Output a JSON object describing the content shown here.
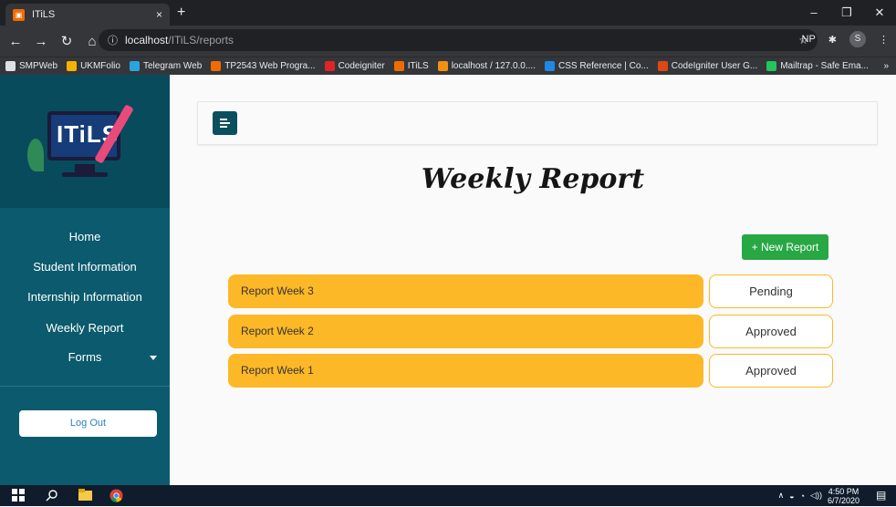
{
  "browser": {
    "tab_title": "ITiLS",
    "tab_close": "×",
    "new_tab": "+",
    "url_host": "localhost",
    "url_path": "/ITiLS/reports",
    "profile_initial": "S",
    "ext_np": "NP",
    "bookmarks": [
      {
        "label": "SMPWeb",
        "color": "#dfe1e5"
      },
      {
        "label": "UKMFolio",
        "color": "#f2b400"
      },
      {
        "label": "Telegram Web",
        "color": "#2aa3df"
      },
      {
        "label": "TP2543 Web Progra...",
        "color": "#ef6c00"
      },
      {
        "label": "Codeigniter",
        "color": "#e02424"
      },
      {
        "label": "ITiLS",
        "color": "#ef6c00"
      },
      {
        "label": "localhost / 127.0.0....",
        "color": "#f29111"
      },
      {
        "label": "CSS Reference | Co...",
        "color": "#1e88e5"
      },
      {
        "label": "CodeIgniter User G...",
        "color": "#dd4814"
      },
      {
        "label": "Mailtrap - Safe Ema...",
        "color": "#22c55e"
      }
    ],
    "bookmarks_more": "»"
  },
  "sidebar": {
    "logo_text": "ITiLS",
    "items": [
      {
        "label": "Home"
      },
      {
        "label": "Student Information"
      },
      {
        "label": "Internship Information"
      },
      {
        "label": "Weekly Report"
      },
      {
        "label": "Forms"
      }
    ],
    "logout_label": "Log Out"
  },
  "main": {
    "title": "Weekly Report",
    "new_report_label": "+ New Report",
    "reports": [
      {
        "label": "Report Week 3",
        "status": "Pending"
      },
      {
        "label": "Report Week 2",
        "status": "Approved"
      },
      {
        "label": "Report Week 1",
        "status": "Approved"
      }
    ]
  },
  "taskbar": {
    "time": "4:50 PM",
    "date": "6/7/2020"
  },
  "colors": {
    "sidebar": "#0b5a6e",
    "report_bar": "#fdb827",
    "new_button": "#28a745"
  }
}
